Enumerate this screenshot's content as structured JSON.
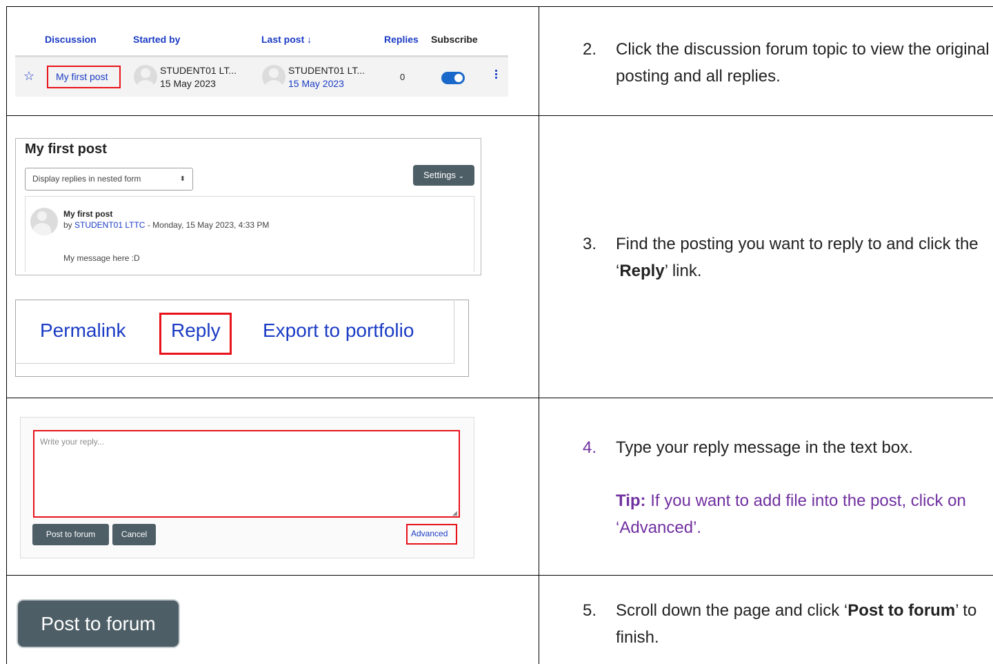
{
  "forum_list": {
    "headers": {
      "discussion": "Discussion",
      "started_by": "Started by",
      "last_post": "Last post ↓",
      "replies": "Replies",
      "subscribe": "Subscribe"
    },
    "row": {
      "discussion": "My first post",
      "started_by_name": "STUDENT01 LT...",
      "started_by_date": "15 May 2023",
      "last_post_name": "STUDENT01 LT...",
      "last_post_date": "15 May 2023",
      "replies": "0",
      "subscribed": true
    }
  },
  "post_view": {
    "title": "My first post",
    "display_mode": "Display replies in nested form",
    "settings_label": "Settings",
    "post": {
      "subject": "My first post",
      "by_prefix": "by ",
      "author": "STUDENT01 LTTC",
      "date": " - Monday, 15 May 2023, 4:33 PM",
      "message": "My message here :D"
    }
  },
  "post_actions": {
    "permalink": "Permalink",
    "reply": "Reply",
    "export": "Export to portfolio"
  },
  "reply_form": {
    "placeholder": "Write your reply...",
    "post_button": "Post to forum",
    "cancel_button": "Cancel",
    "advanced_link": "Advanced"
  },
  "big_button": {
    "label": "Post to forum"
  },
  "instructions": {
    "step2": {
      "num": "2.",
      "text": "Click the discussion forum topic to view the original posting and all replies."
    },
    "step3": {
      "num": "3.",
      "pre": "Find the posting you want to reply to and click the ‘",
      "bold": "Reply",
      "post": "’ link."
    },
    "step4": {
      "num": "4.",
      "text": "Type your reply message in the text box."
    },
    "tip": {
      "label": "Tip:",
      "text": " If you want to add file into the post, click on ‘Advanced’."
    },
    "step5": {
      "num": "5.",
      "pre": "Scroll down the page and click ‘",
      "bold": "Post to forum",
      "post": "’ to finish."
    }
  },
  "colors": {
    "link": "#1a3bc4",
    "highlight_red": "#e8121a",
    "button_dark": "#4d5e66",
    "tip_purple": "#7030a0",
    "toggle_blue": "#1a68c9"
  }
}
